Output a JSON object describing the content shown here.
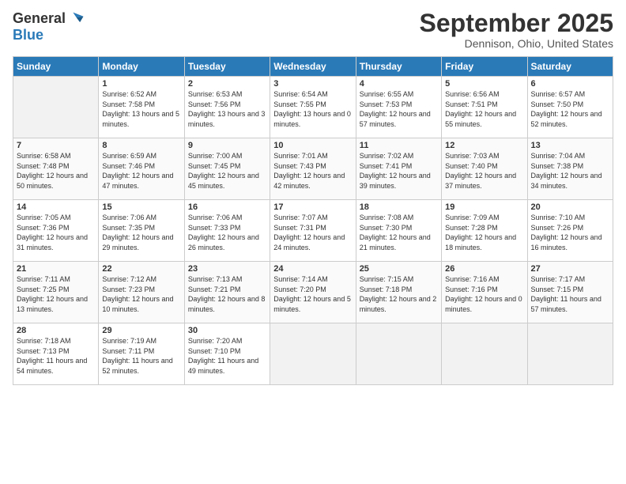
{
  "logo": {
    "general": "General",
    "blue": "Blue"
  },
  "title": "September 2025",
  "subtitle": "Dennison, Ohio, United States",
  "days_of_week": [
    "Sunday",
    "Monday",
    "Tuesday",
    "Wednesday",
    "Thursday",
    "Friday",
    "Saturday"
  ],
  "weeks": [
    [
      {
        "num": "",
        "sunrise": "",
        "sunset": "",
        "daylight": ""
      },
      {
        "num": "1",
        "sunrise": "Sunrise: 6:52 AM",
        "sunset": "Sunset: 7:58 PM",
        "daylight": "Daylight: 13 hours and 5 minutes."
      },
      {
        "num": "2",
        "sunrise": "Sunrise: 6:53 AM",
        "sunset": "Sunset: 7:56 PM",
        "daylight": "Daylight: 13 hours and 3 minutes."
      },
      {
        "num": "3",
        "sunrise": "Sunrise: 6:54 AM",
        "sunset": "Sunset: 7:55 PM",
        "daylight": "Daylight: 13 hours and 0 minutes."
      },
      {
        "num": "4",
        "sunrise": "Sunrise: 6:55 AM",
        "sunset": "Sunset: 7:53 PM",
        "daylight": "Daylight: 12 hours and 57 minutes."
      },
      {
        "num": "5",
        "sunrise": "Sunrise: 6:56 AM",
        "sunset": "Sunset: 7:51 PM",
        "daylight": "Daylight: 12 hours and 55 minutes."
      },
      {
        "num": "6",
        "sunrise": "Sunrise: 6:57 AM",
        "sunset": "Sunset: 7:50 PM",
        "daylight": "Daylight: 12 hours and 52 minutes."
      }
    ],
    [
      {
        "num": "7",
        "sunrise": "Sunrise: 6:58 AM",
        "sunset": "Sunset: 7:48 PM",
        "daylight": "Daylight: 12 hours and 50 minutes."
      },
      {
        "num": "8",
        "sunrise": "Sunrise: 6:59 AM",
        "sunset": "Sunset: 7:46 PM",
        "daylight": "Daylight: 12 hours and 47 minutes."
      },
      {
        "num": "9",
        "sunrise": "Sunrise: 7:00 AM",
        "sunset": "Sunset: 7:45 PM",
        "daylight": "Daylight: 12 hours and 45 minutes."
      },
      {
        "num": "10",
        "sunrise": "Sunrise: 7:01 AM",
        "sunset": "Sunset: 7:43 PM",
        "daylight": "Daylight: 12 hours and 42 minutes."
      },
      {
        "num": "11",
        "sunrise": "Sunrise: 7:02 AM",
        "sunset": "Sunset: 7:41 PM",
        "daylight": "Daylight: 12 hours and 39 minutes."
      },
      {
        "num": "12",
        "sunrise": "Sunrise: 7:03 AM",
        "sunset": "Sunset: 7:40 PM",
        "daylight": "Daylight: 12 hours and 37 minutes."
      },
      {
        "num": "13",
        "sunrise": "Sunrise: 7:04 AM",
        "sunset": "Sunset: 7:38 PM",
        "daylight": "Daylight: 12 hours and 34 minutes."
      }
    ],
    [
      {
        "num": "14",
        "sunrise": "Sunrise: 7:05 AM",
        "sunset": "Sunset: 7:36 PM",
        "daylight": "Daylight: 12 hours and 31 minutes."
      },
      {
        "num": "15",
        "sunrise": "Sunrise: 7:06 AM",
        "sunset": "Sunset: 7:35 PM",
        "daylight": "Daylight: 12 hours and 29 minutes."
      },
      {
        "num": "16",
        "sunrise": "Sunrise: 7:06 AM",
        "sunset": "Sunset: 7:33 PM",
        "daylight": "Daylight: 12 hours and 26 minutes."
      },
      {
        "num": "17",
        "sunrise": "Sunrise: 7:07 AM",
        "sunset": "Sunset: 7:31 PM",
        "daylight": "Daylight: 12 hours and 24 minutes."
      },
      {
        "num": "18",
        "sunrise": "Sunrise: 7:08 AM",
        "sunset": "Sunset: 7:30 PM",
        "daylight": "Daylight: 12 hours and 21 minutes."
      },
      {
        "num": "19",
        "sunrise": "Sunrise: 7:09 AM",
        "sunset": "Sunset: 7:28 PM",
        "daylight": "Daylight: 12 hours and 18 minutes."
      },
      {
        "num": "20",
        "sunrise": "Sunrise: 7:10 AM",
        "sunset": "Sunset: 7:26 PM",
        "daylight": "Daylight: 12 hours and 16 minutes."
      }
    ],
    [
      {
        "num": "21",
        "sunrise": "Sunrise: 7:11 AM",
        "sunset": "Sunset: 7:25 PM",
        "daylight": "Daylight: 12 hours and 13 minutes."
      },
      {
        "num": "22",
        "sunrise": "Sunrise: 7:12 AM",
        "sunset": "Sunset: 7:23 PM",
        "daylight": "Daylight: 12 hours and 10 minutes."
      },
      {
        "num": "23",
        "sunrise": "Sunrise: 7:13 AM",
        "sunset": "Sunset: 7:21 PM",
        "daylight": "Daylight: 12 hours and 8 minutes."
      },
      {
        "num": "24",
        "sunrise": "Sunrise: 7:14 AM",
        "sunset": "Sunset: 7:20 PM",
        "daylight": "Daylight: 12 hours and 5 minutes."
      },
      {
        "num": "25",
        "sunrise": "Sunrise: 7:15 AM",
        "sunset": "Sunset: 7:18 PM",
        "daylight": "Daylight: 12 hours and 2 minutes."
      },
      {
        "num": "26",
        "sunrise": "Sunrise: 7:16 AM",
        "sunset": "Sunset: 7:16 PM",
        "daylight": "Daylight: 12 hours and 0 minutes."
      },
      {
        "num": "27",
        "sunrise": "Sunrise: 7:17 AM",
        "sunset": "Sunset: 7:15 PM",
        "daylight": "Daylight: 11 hours and 57 minutes."
      }
    ],
    [
      {
        "num": "28",
        "sunrise": "Sunrise: 7:18 AM",
        "sunset": "Sunset: 7:13 PM",
        "daylight": "Daylight: 11 hours and 54 minutes."
      },
      {
        "num": "29",
        "sunrise": "Sunrise: 7:19 AM",
        "sunset": "Sunset: 7:11 PM",
        "daylight": "Daylight: 11 hours and 52 minutes."
      },
      {
        "num": "30",
        "sunrise": "Sunrise: 7:20 AM",
        "sunset": "Sunset: 7:10 PM",
        "daylight": "Daylight: 11 hours and 49 minutes."
      },
      {
        "num": "",
        "sunrise": "",
        "sunset": "",
        "daylight": ""
      },
      {
        "num": "",
        "sunrise": "",
        "sunset": "",
        "daylight": ""
      },
      {
        "num": "",
        "sunrise": "",
        "sunset": "",
        "daylight": ""
      },
      {
        "num": "",
        "sunrise": "",
        "sunset": "",
        "daylight": ""
      }
    ]
  ]
}
